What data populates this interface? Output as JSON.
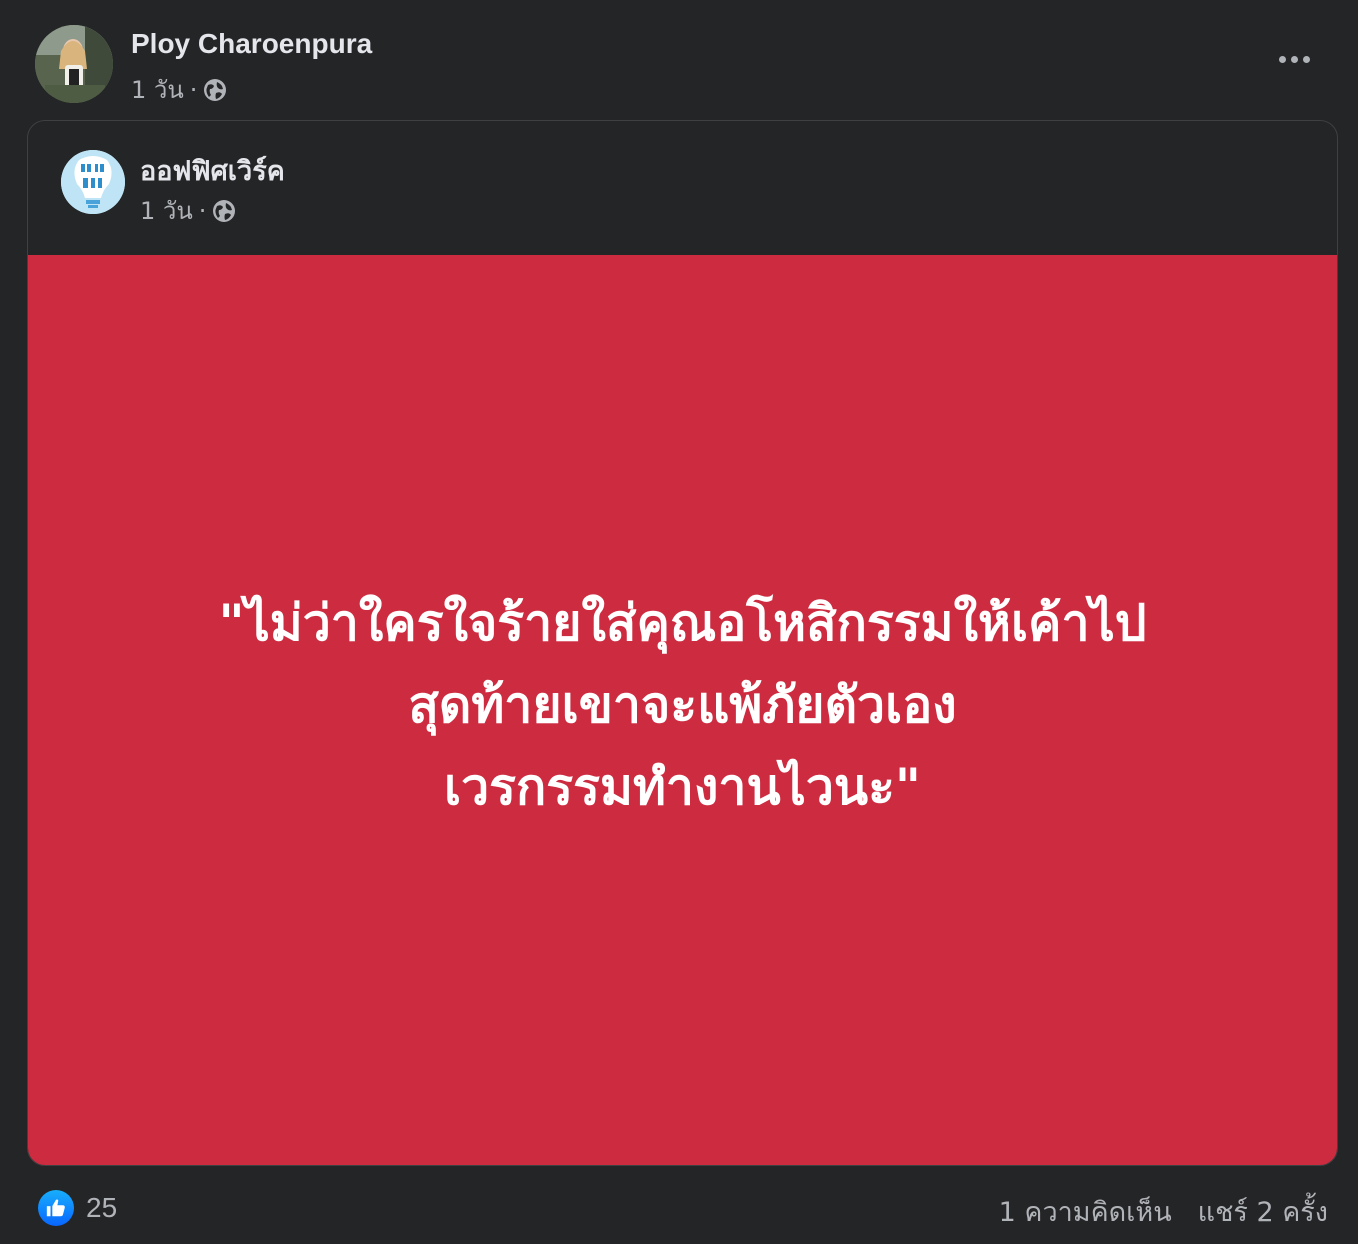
{
  "post": {
    "author": "Ploy Charoenpura",
    "time": "1 วัน",
    "separator": "·",
    "privacy_icon": "globe-icon",
    "more_icon": "more-options-icon"
  },
  "shared": {
    "page_name": "ออฟฟิศเวิร์ค",
    "time": "1 วัน",
    "separator": "·",
    "privacy_icon": "globe-icon",
    "image": {
      "background": "#cd2b40",
      "lines": [
        "\"ไม่ว่าใครใจร้ายใส่คุณอโหสิกรรมให้เค้าไป",
        "สุดท้ายเขาจะแพ้ภัยตัวเอง",
        "เวรกรรมทำงานไวนะ\""
      ]
    }
  },
  "footer": {
    "like_icon": "like-icon",
    "like_count": "25",
    "comments": "1 ความคิดเห็น",
    "shares": "แชร์ 2 ครั้ง"
  },
  "colors": {
    "background": "#242526",
    "text_primary": "#e4e6eb",
    "text_secondary": "#b0b3b8",
    "like_blue": "#0866ff"
  }
}
